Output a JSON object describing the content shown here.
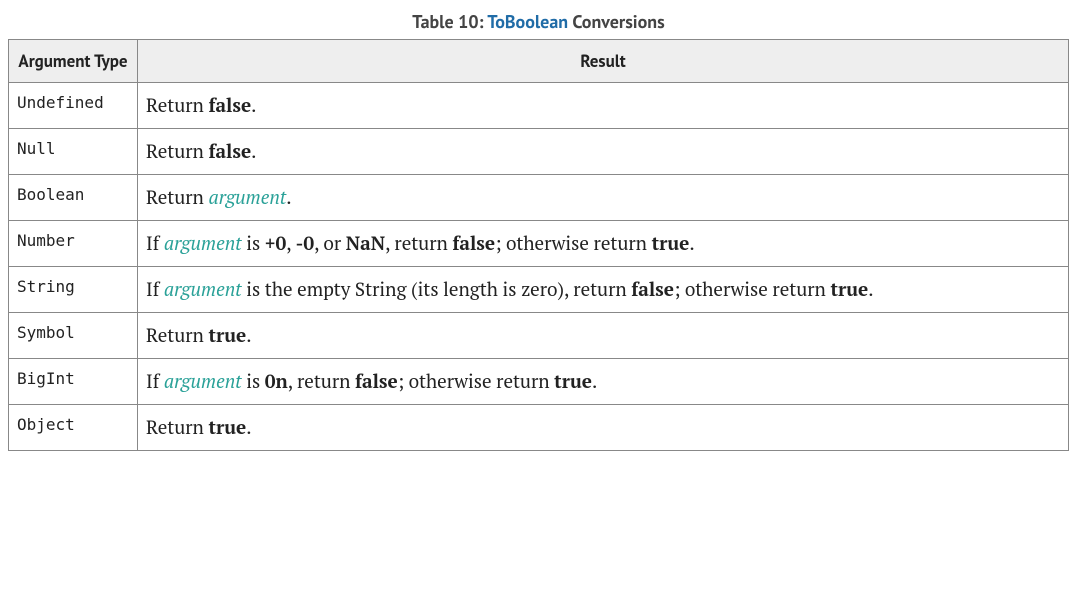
{
  "caption": {
    "prefix": "Table 10: ",
    "aoid": "ToBoolean",
    "suffix": " Conversions"
  },
  "headers": {
    "c1": "Argument Type",
    "c2": "Result"
  },
  "rows": {
    "undefined": {
      "type": "Undefined",
      "r": "Return ",
      "false": "false",
      "dot": "."
    },
    "null": {
      "type": "Null",
      "r": "Return ",
      "false": "false",
      "dot": "."
    },
    "boolean": {
      "type": "Boolean",
      "r": "Return ",
      "arg": "argument",
      "dot": "."
    },
    "number": {
      "type": "Number",
      "t1": "If ",
      "arg": "argument",
      "t2": " is ",
      "pz": "+0",
      "c1": ", ",
      "nz": "-0",
      "c2": ", or ",
      "nan": "NaN",
      "t3": ", return ",
      "false": "false",
      "t4": "; otherwise return ",
      "true": "true",
      "dot": "."
    },
    "string": {
      "type": "String",
      "t1": "If ",
      "arg": "argument",
      "t2": " is the empty String (its length is zero), return ",
      "false": "false",
      "t3": "; otherwise return ",
      "true": "true",
      "dot": "."
    },
    "symbol": {
      "type": "Symbol",
      "r": "Return ",
      "true": "true",
      "dot": "."
    },
    "bigint": {
      "type": "BigInt",
      "t1": "If ",
      "arg": "argument",
      "t2": " is ",
      "zn": "0n",
      "t3": ", return ",
      "false": "false",
      "t4": "; otherwise return ",
      "true": "true",
      "dot": "."
    },
    "object": {
      "type": "Object",
      "r": "Return ",
      "true": "true",
      "dot": "."
    }
  },
  "chart_data": {
    "type": "table",
    "title": "Table 10: ToBoolean Conversions",
    "columns": [
      "Argument Type",
      "Result"
    ],
    "rows": [
      [
        "Undefined",
        "Return false."
      ],
      [
        "Null",
        "Return false."
      ],
      [
        "Boolean",
        "Return argument."
      ],
      [
        "Number",
        "If argument is +0, -0, or NaN, return false; otherwise return true."
      ],
      [
        "String",
        "If argument is the empty String (its length is zero), return false; otherwise return true."
      ],
      [
        "Symbol",
        "Return true."
      ],
      [
        "BigInt",
        "If argument is 0n, return false; otherwise return true."
      ],
      [
        "Object",
        "Return true."
      ]
    ]
  }
}
